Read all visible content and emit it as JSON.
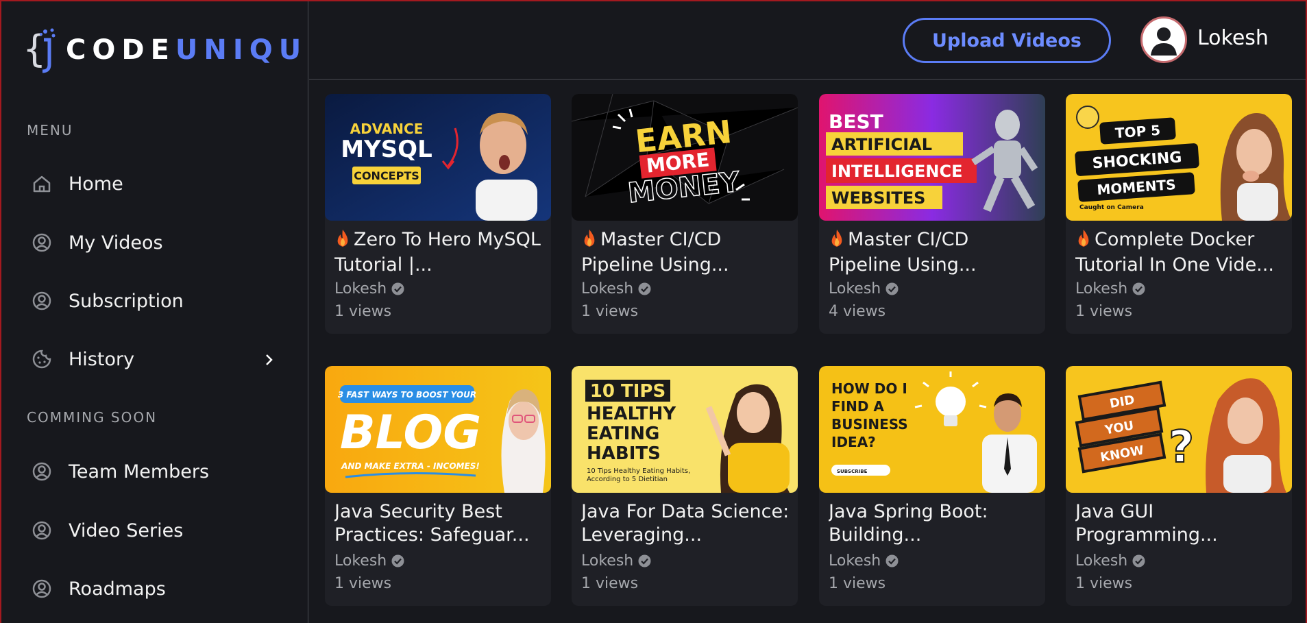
{
  "brand": {
    "part1": "CODE",
    "part2": "UNIQU"
  },
  "sidebar": {
    "menu_title": "MENU",
    "items": [
      {
        "label": "Home",
        "icon": "home-icon"
      },
      {
        "label": "My Videos",
        "icon": "user-circle-icon"
      },
      {
        "label": "Subscription",
        "icon": "user-circle-icon"
      },
      {
        "label": "History",
        "icon": "cookie-icon"
      }
    ],
    "coming_soon_title": "COMMING SOON",
    "coming_items": [
      {
        "label": "Team Members",
        "icon": "user-circle-icon"
      },
      {
        "label": "Video Series",
        "icon": "user-circle-icon"
      },
      {
        "label": "Roadmaps",
        "icon": "user-circle-icon"
      }
    ]
  },
  "header": {
    "upload_label": "Upload Videos",
    "username": "Lokesh"
  },
  "videos": [
    {
      "title": "Zero To Hero MySQL Tutorial |...",
      "fire": true,
      "channel": "Lokesh",
      "views": "1 views",
      "thumb": {
        "line1": "ADVANCE",
        "line2": "MYSQL",
        "line3": "CONCEPTS"
      }
    },
    {
      "title": "Master CI/CD Pipeline Using...",
      "fire": true,
      "channel": "Lokesh",
      "views": "1 views",
      "thumb": {
        "line1": "EARN",
        "line2": "MORE",
        "line3": "MONEY"
      }
    },
    {
      "title": "Master CI/CD Pipeline Using...",
      "fire": true,
      "channel": "Lokesh",
      "views": "4 views",
      "thumb": {
        "line1": "BEST",
        "line2": "ARTIFICIAL",
        "line3": "INTELLIGENCE",
        "line4": "WEBSITES"
      }
    },
    {
      "title": "Complete Docker Tutorial In One Vide...",
      "fire": true,
      "channel": "Lokesh",
      "views": "1 views",
      "thumb": {
        "line1": "TOP 5",
        "line2": "SHOCKING",
        "line3": "MOMENTS",
        "line4": "Caught on Camera"
      }
    },
    {
      "title": "Java Security Best Practices: Safeguar...",
      "fire": false,
      "channel": "Lokesh",
      "views": "1 views",
      "thumb": {
        "line1": "3 FAST WAYS TO BOOST YOUR",
        "line2": "BLOG",
        "line3": "AND MAKE EXTRA - INCOMES!"
      }
    },
    {
      "title": "Java For Data Science: Leveraging...",
      "fire": false,
      "channel": "Lokesh",
      "views": "1 views",
      "thumb": {
        "line1": "10 TIPS",
        "line2": "HEALTHY",
        "line3": "EATING",
        "line4": "HABITS",
        "line5": "10 Tips Healthy Eating Habits,",
        "line6": "According to 5 Dietitian"
      }
    },
    {
      "title": "Java Spring Boot: Building...",
      "fire": false,
      "channel": "Lokesh",
      "views": "1 views",
      "thumb": {
        "line1": "HOW DO I",
        "line2": "FIND A",
        "line3": "BUSINESS",
        "line4": "IDEA?",
        "line5": "SUBSCRIBE"
      }
    },
    {
      "title": "Java GUI Programming...",
      "fire": false,
      "channel": "Lokesh",
      "views": "1 views",
      "thumb": {
        "line1": "DID",
        "line2": "YOU",
        "line3": "KNOW"
      }
    }
  ],
  "colors": {
    "accent": "#5b7cf5",
    "bg": "#17181d",
    "card": "#1f2026",
    "muted": "#a6a8ad"
  }
}
